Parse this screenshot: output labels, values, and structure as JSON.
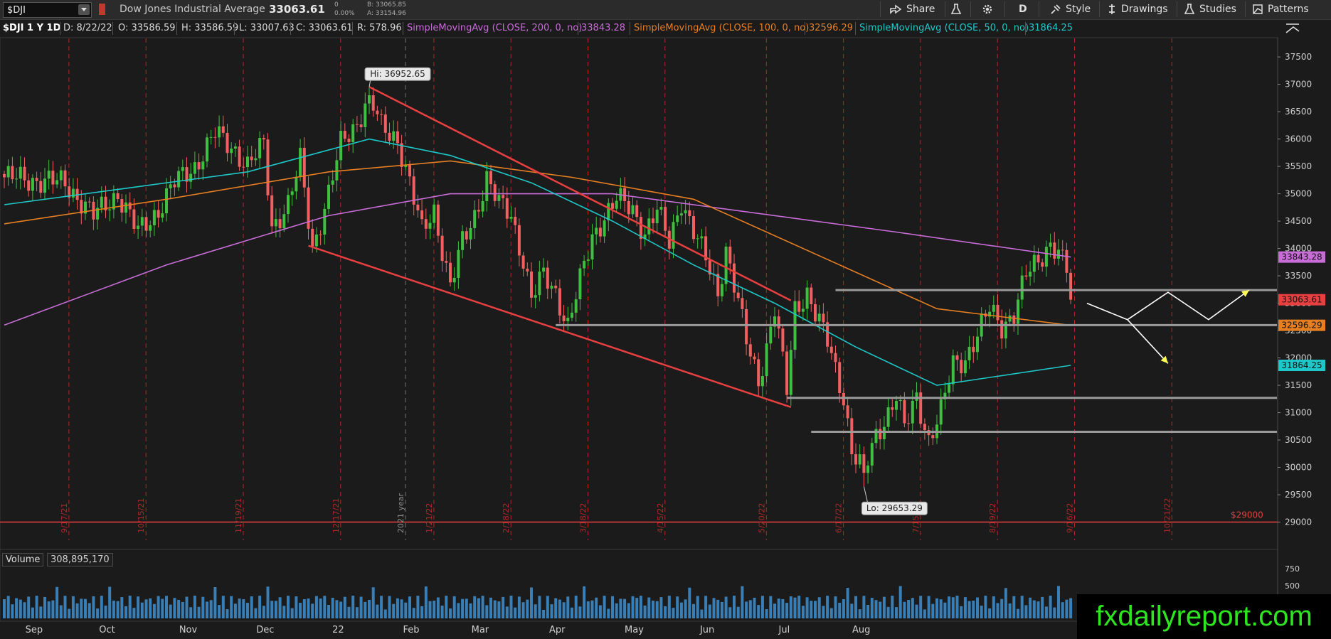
{
  "toolbar": {
    "symbol": "$DJI",
    "name": "Dow Jones Industrial Average",
    "last": "33063.61",
    "change": "0",
    "change_pct": "0.00%",
    "bid": "B: 33065.85",
    "ask": "A: 33154.96",
    "buttons": {
      "share": "Share",
      "period": "D",
      "style": "Style",
      "drawings": "Drawings",
      "studies": "Studies",
      "patterns": "Patterns"
    }
  },
  "infobar": {
    "symbol_period": "$DJI 1 Y 1D",
    "date": "D: 8/22/22",
    "open": "O: 33586.59",
    "high": "H: 33586.59",
    "low": "L: 33007.63",
    "close": "C: 33063.61",
    "range": "R: 578.96",
    "sma200_label": "SimpleMovingAvg (CLOSE, 200, 0, no)",
    "sma200_value": "33843.28",
    "sma100_label": "SimpleMovingAvg (CLOSE, 100, 0, no)",
    "sma100_value": "32596.29",
    "sma50_label": "SimpleMovingAvg (CLOSE, 50, 0, no)",
    "sma50_value": "31864.25"
  },
  "volume": {
    "label": "Volume",
    "value": "308,895,170",
    "axis_ticks": [
      "750",
      "500"
    ]
  },
  "brand": "fxdailyreport.com",
  "colors": {
    "background": "#1b1b1b",
    "up": "#3fbf3f",
    "down": "#f06060",
    "sma200": "#c86cd8",
    "sma100": "#e67e22",
    "sma50": "#1ec8c8",
    "trendline": "#e84040",
    "level": "#9a9a9a",
    "projection": "#ffff55",
    "volume": "#3e8fd0"
  },
  "chart_data": {
    "type": "candlestick",
    "title": "Dow Jones Industrial Average",
    "ylim": [
      28800,
      37800
    ],
    "y_ticks": [
      29000,
      29500,
      30000,
      30500,
      31000,
      31500,
      32000,
      32500,
      33000,
      33500,
      34000,
      34500,
      35000,
      35500,
      36000,
      36500,
      37000,
      37500
    ],
    "x_month_labels": [
      "Sep",
      "Oct",
      "Nov",
      "Dec",
      "22",
      "Feb",
      "Mar",
      "Apr",
      "May",
      "Jun",
      "Jul",
      "Aug"
    ],
    "x_date_markers": [
      "9/17/21",
      "10/15/21",
      "11/19/21",
      "12/17/21",
      "2021 year",
      "1/21/22",
      "2/18/22",
      "3/18/22",
      "4/15/22",
      "5/20/22",
      "6/17/22",
      "7/15/22",
      "8/19/22",
      "9/16/22",
      "10/21/22"
    ],
    "close_path": [
      [
        0,
        35300
      ],
      [
        15,
        35200
      ],
      [
        22,
        34600
      ],
      [
        28,
        35000
      ],
      [
        33,
        34300
      ],
      [
        38,
        34700
      ],
      [
        42,
        35200
      ],
      [
        47,
        35500
      ],
      [
        52,
        36100
      ],
      [
        57,
        35800
      ],
      [
        60,
        35500
      ],
      [
        64,
        35900
      ],
      [
        66,
        34400
      ],
      [
        70,
        34800
      ],
      [
        73,
        35600
      ],
      [
        76,
        34000
      ],
      [
        80,
        35000
      ],
      [
        83,
        35900
      ],
      [
        87,
        36300
      ],
      [
        90,
        36800
      ],
      [
        93,
        36200
      ],
      [
        97,
        36000
      ],
      [
        100,
        35200
      ],
      [
        103,
        34300
      ],
      [
        106,
        34700
      ],
      [
        110,
        33300
      ],
      [
        113,
        34100
      ],
      [
        116,
        34600
      ],
      [
        119,
        35300
      ],
      [
        122,
        34800
      ],
      [
        125,
        34600
      ],
      [
        128,
        33800
      ],
      [
        130,
        33100
      ],
      [
        133,
        33500
      ],
      [
        136,
        33200
      ],
      [
        139,
        32600
      ],
      [
        142,
        33400
      ],
      [
        145,
        34200
      ],
      [
        148,
        34600
      ],
      [
        151,
        34900
      ],
      [
        155,
        34700
      ],
      [
        158,
        34300
      ],
      [
        161,
        34700
      ],
      [
        164,
        34100
      ],
      [
        167,
        34900
      ],
      [
        170,
        34300
      ],
      [
        173,
        33800
      ],
      [
        176,
        33200
      ],
      [
        178,
        34000
      ],
      [
        181,
        33000
      ],
      [
        183,
        32300
      ],
      [
        186,
        31600
      ],
      [
        188,
        32200
      ],
      [
        190,
        32900
      ],
      [
        193,
        31400
      ],
      [
        195,
        32900
      ],
      [
        198,
        33200
      ],
      [
        200,
        32800
      ],
      [
        203,
        32300
      ],
      [
        205,
        31800
      ],
      [
        207,
        31300
      ],
      [
        209,
        30300
      ],
      [
        212,
        29900
      ],
      [
        215,
        30600
      ],
      [
        218,
        31000
      ],
      [
        220,
        31300
      ],
      [
        222,
        30700
      ],
      [
        225,
        31300
      ],
      [
        228,
        30500
      ],
      [
        231,
        31000
      ],
      [
        234,
        31900
      ],
      [
        237,
        32000
      ],
      [
        240,
        32400
      ],
      [
        243,
        32900
      ],
      [
        246,
        32600
      ],
      [
        249,
        32800
      ],
      [
        252,
        33500
      ],
      [
        255,
        33800
      ],
      [
        258,
        34100
      ],
      [
        260,
        33900
      ],
      [
        262,
        33600
      ],
      [
        263,
        33063.61
      ]
    ],
    "events": [
      {
        "label": "Hi: 36952.65",
        "t": 90,
        "value": 36952.65
      },
      {
        "label": "Lo: 29653.29",
        "t": 212,
        "value": 29653.29
      }
    ],
    "series": [
      {
        "name": "SimpleMovingAvg (CLOSE, 200, 0, no)",
        "last": 33843.28,
        "points": [
          [
            0,
            32600
          ],
          [
            40,
            33700
          ],
          [
            80,
            34600
          ],
          [
            110,
            35000
          ],
          [
            150,
            35000
          ],
          [
            180,
            34700
          ],
          [
            220,
            34300
          ],
          [
            263,
            33843.28
          ]
        ]
      },
      {
        "name": "SimpleMovingAvg (CLOSE, 100, 0, no)",
        "last": 32596.29,
        "points": [
          [
            0,
            34450
          ],
          [
            40,
            34900
          ],
          [
            80,
            35400
          ],
          [
            110,
            35600
          ],
          [
            140,
            35300
          ],
          [
            170,
            34900
          ],
          [
            200,
            33900
          ],
          [
            230,
            32900
          ],
          [
            263,
            32596.29
          ]
        ]
      },
      {
        "name": "SimpleMovingAvg (CLOSE, 50, 0, no)",
        "last": 31864.25,
        "points": [
          [
            0,
            34800
          ],
          [
            30,
            35100
          ],
          [
            60,
            35400
          ],
          [
            90,
            36000
          ],
          [
            110,
            35700
          ],
          [
            130,
            35200
          ],
          [
            150,
            34500
          ],
          [
            170,
            33700
          ],
          [
            190,
            33000
          ],
          [
            210,
            32200
          ],
          [
            230,
            31500
          ],
          [
            263,
            31864.25
          ]
        ]
      }
    ],
    "price_flags": [
      {
        "value": 33843.28,
        "label": "33843.28",
        "color": "#c86cd8"
      },
      {
        "value": 33063.61,
        "label": "33063.61",
        "color": "#e84040"
      },
      {
        "value": 32596.29,
        "label": "32596.29",
        "color": "#e67e22"
      },
      {
        "value": 31864.25,
        "label": "31864.25",
        "color": "#1ec8c8"
      }
    ],
    "floor_label": "$29000",
    "annotations": {
      "trendlines": [
        {
          "from": [
            90,
            36952.65
          ],
          "to": [
            194,
            33050
          ]
        },
        {
          "from": [
            75,
            34050
          ],
          "to": [
            194,
            31100
          ]
        }
      ],
      "horizontal_levels": [
        {
          "value": 33240,
          "from_t": 205
        },
        {
          "value": 32600,
          "from_t": 136
        },
        {
          "value": 31270,
          "from_t": 193
        },
        {
          "value": 30650,
          "from_t": 199
        }
      ],
      "projection_paths": [
        [
          [
            267,
            33000
          ],
          [
            277,
            32700
          ],
          [
            287,
            33200
          ],
          [
            297,
            32700
          ],
          [
            307,
            33240
          ]
        ],
        [
          [
            277,
            32700
          ],
          [
            287,
            31900
          ]
        ]
      ]
    }
  }
}
